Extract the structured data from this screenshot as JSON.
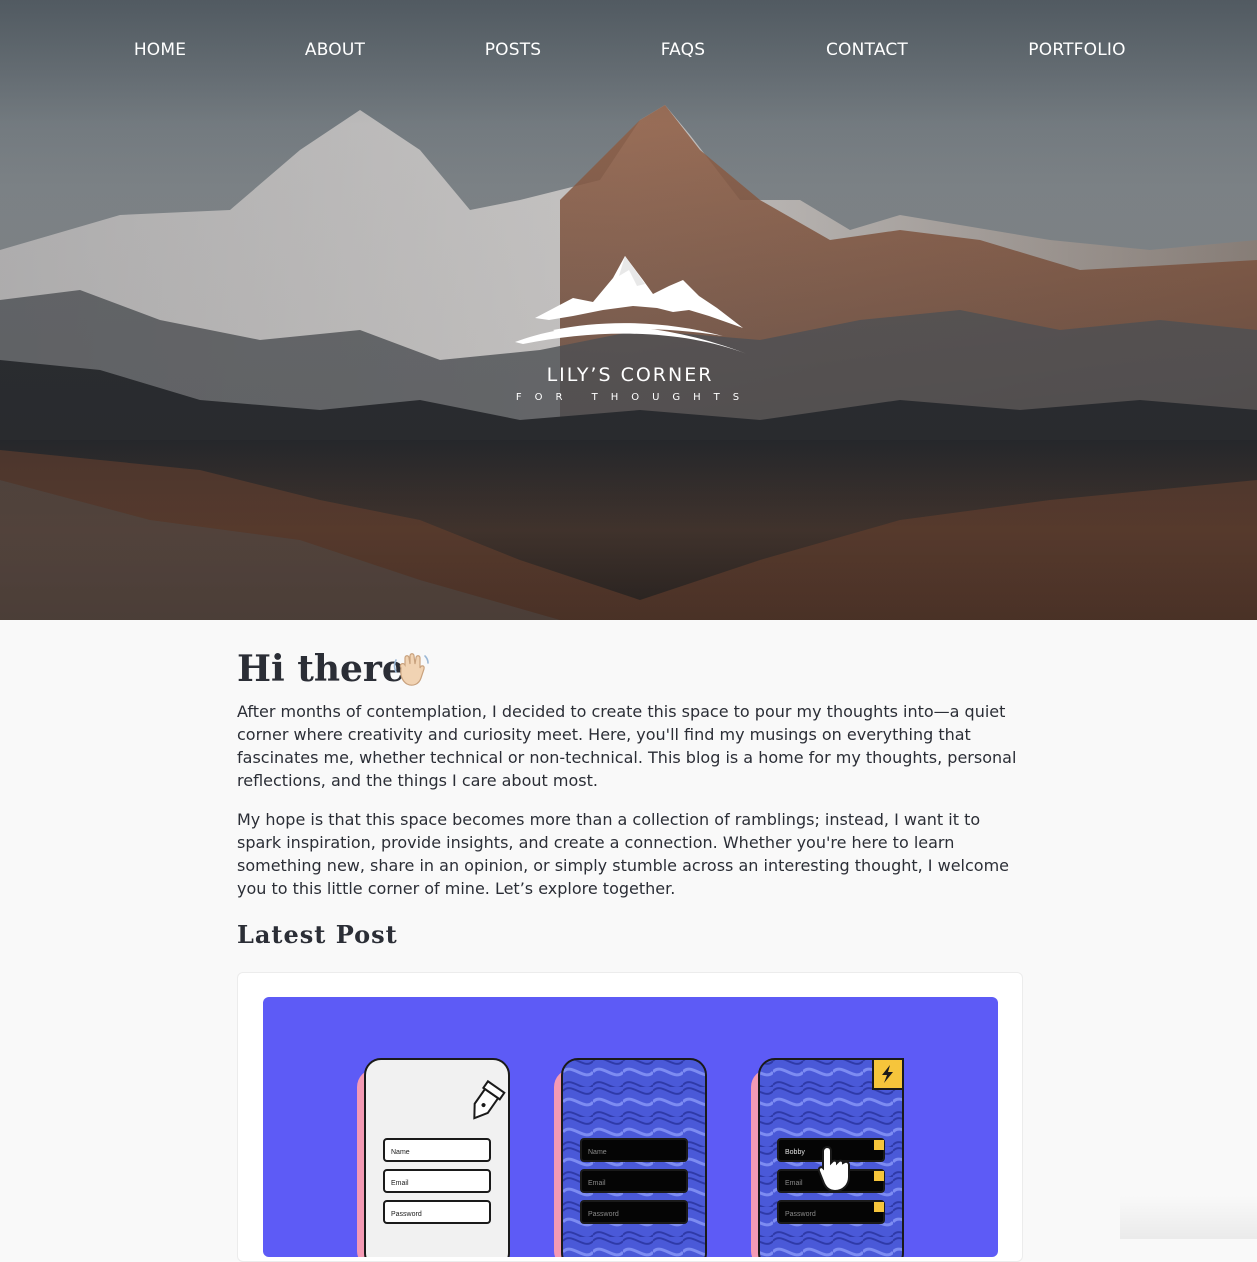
{
  "nav": {
    "items": [
      "HOME",
      "ABOUT",
      "POSTS",
      "FAQS",
      "CONTACT",
      "PORTFOLIO"
    ]
  },
  "logo": {
    "title": "LILY’S CORNER",
    "subtitle": "FOR THOUGHTS"
  },
  "intro": {
    "heading": "Hi there",
    "emoji": "waving-hand",
    "paragraph1": "After months of contemplation, I decided to create this space to pour my thoughts into—a quiet corner where creativity and curiosity meet. Here, you'll find my musings on everything that fascinates me, whether technical or non-technical. This blog is a home for my thoughts, personal reflections, and the things I care about most.",
    "paragraph2": "My hope is that this space becomes more than a collection of ramblings; instead, I want it to spark inspiration, provide insights, and create a connection. Whether you're here to learn something new, share in an opinion, or simply stumble across an interesting thought, I welcome you to this little corner of mine. Let’s explore together."
  },
  "latest": {
    "heading": "Latest Post",
    "image": {
      "background": "#5d5bf6",
      "forms": [
        {
          "fields": [
            "Name",
            "Email",
            "Password"
          ]
        },
        {
          "fields": [
            "Name",
            "Email",
            "Password"
          ]
        },
        {
          "fields": [
            "Bobby",
            "Email",
            "Password"
          ]
        }
      ]
    }
  },
  "colors": {
    "text": "#2b2e36",
    "page_bg": "#f9f9f9",
    "accent_purple": "#5d5bf6",
    "accent_pink": "#f49ab4",
    "accent_yellow": "#f6c53b"
  }
}
